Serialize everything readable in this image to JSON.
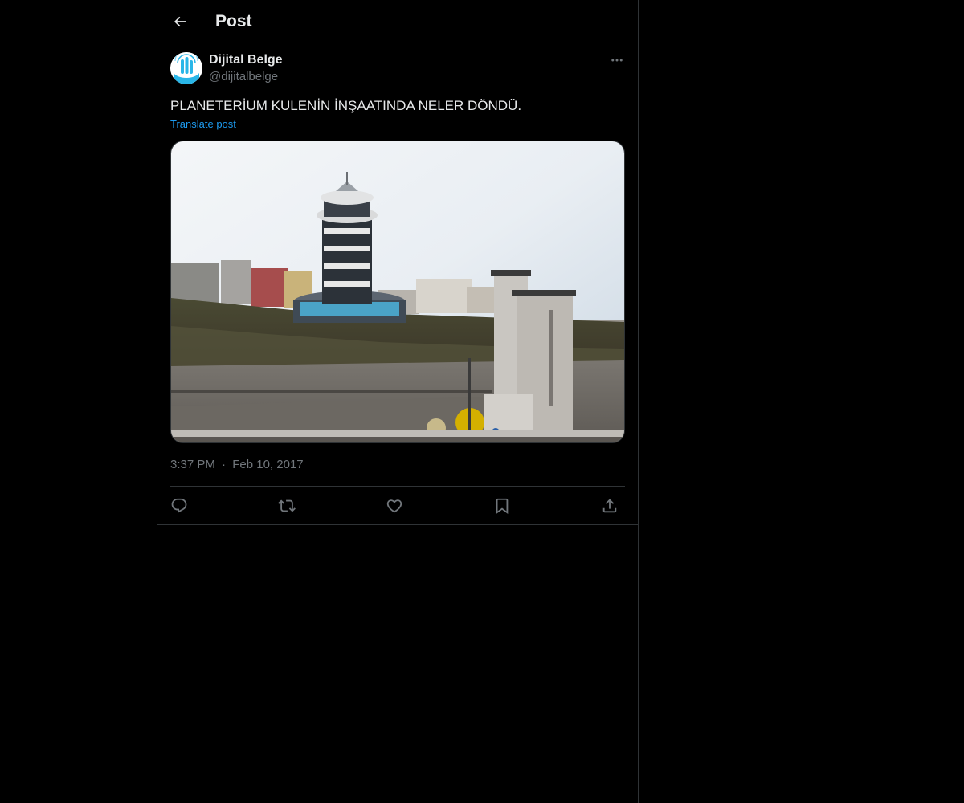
{
  "header": {
    "title": "Post",
    "back_icon": "arrow-left-icon"
  },
  "post": {
    "author": {
      "name": "Dijital Belge",
      "handle": "@dijitalbelge",
      "avatar_icon": "hand-tap-logo"
    },
    "text": "PLANETERİUM KULENİN İNŞAATINDA NELER DÖNDÜ.",
    "translate_label": "Translate post",
    "image_description_icon": "photo",
    "time": "3:37 PM",
    "separator": "·",
    "date": "Feb 10, 2017"
  },
  "actions": [
    {
      "icon": "reply-icon"
    },
    {
      "icon": "repost-icon"
    },
    {
      "icon": "like-icon"
    },
    {
      "icon": "bookmark-icon"
    },
    {
      "icon": "share-icon"
    }
  ],
  "colors": {
    "background": "#000000",
    "text_primary": "#e7e9ea",
    "text_secondary": "#71767b",
    "accent": "#1d9bf0",
    "border": "#2f3336"
  }
}
